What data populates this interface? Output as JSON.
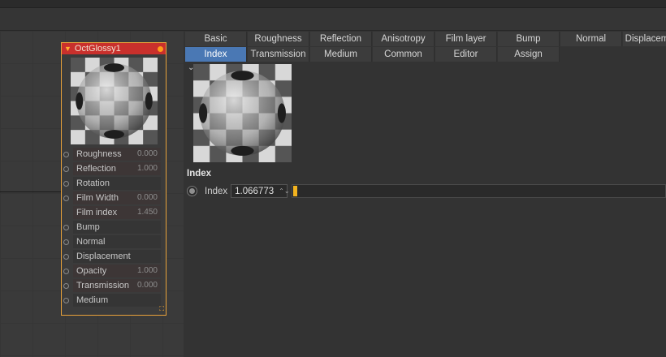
{
  "node": {
    "title": "OctGlossy1",
    "ports": [
      {
        "label": "Roughness",
        "value": "0.000",
        "pin": true
      },
      {
        "label": "Reflection",
        "value": "1.000",
        "pin": true
      },
      {
        "label": "Rotation",
        "value": "",
        "pin": true
      },
      {
        "label": "Film Width",
        "value": "0.000",
        "pin": true
      },
      {
        "label": "Film index",
        "value": "1.450",
        "pin": false
      },
      {
        "label": "Bump",
        "value": "",
        "pin": true
      },
      {
        "label": "Normal",
        "value": "",
        "pin": true
      },
      {
        "label": "Displacement",
        "value": "",
        "pin": true
      },
      {
        "label": "Opacity",
        "value": "1.000",
        "pin": true
      },
      {
        "label": "Transmission",
        "value": "0.000",
        "pin": true
      },
      {
        "label": "Medium",
        "value": "",
        "pin": true
      }
    ]
  },
  "tabs": {
    "row1": [
      "Basic",
      "Roughness",
      "Reflection",
      "Anisotropy",
      "Film layer",
      "Bump",
      "Normal",
      "Displacement"
    ],
    "row2": [
      "Index",
      "Transmission",
      "Medium",
      "Common",
      "Editor",
      "Assign"
    ],
    "active": "Index"
  },
  "section": {
    "title": "Index",
    "param_label": "Index",
    "param_value": "1.066773",
    "slider_fraction": 0.012
  },
  "colors": {
    "node_header": "#c9302c",
    "node_border": "#e8a23a",
    "active_tab": "#4a78b4",
    "slider_fill": "#f3b31f"
  },
  "icons": {
    "collapse": "chevron-down-icon",
    "node_toggle": "triangle-down-icon",
    "node_status": "dot-icon",
    "stepper": "up-down-stepper-icon"
  }
}
